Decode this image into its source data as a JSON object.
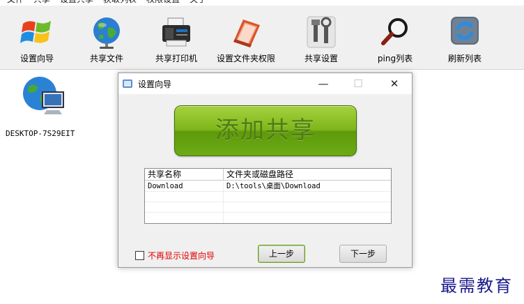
{
  "menubar": {
    "items": [
      "文件",
      "共享",
      "设置共享",
      "获取列表",
      "权限设置",
      "关于"
    ]
  },
  "toolbar": {
    "buttons": [
      {
        "label": "设置向导",
        "icon": "windows-logo-icon"
      },
      {
        "label": "共享文件",
        "icon": "globe-icon"
      },
      {
        "label": "共享打印机",
        "icon": "printer-icon"
      },
      {
        "label": "设置文件夹权限",
        "icon": "folder-permission-icon"
      },
      {
        "label": "共享设置",
        "icon": "tools-icon"
      },
      {
        "label": "ping列表",
        "icon": "magnifier-icon"
      },
      {
        "label": "刷新列表",
        "icon": "refresh-icon"
      }
    ]
  },
  "host": {
    "name": "DESKTOP-7S29EIT",
    "icon": "network-computer-icon"
  },
  "dialog": {
    "title": "设置向导",
    "minimize": "—",
    "maximize": "☐",
    "close": "✕",
    "add_share_label": "添加共享",
    "table": {
      "columns": [
        "共享名称",
        "文件夹或磁盘路径"
      ],
      "rows": [
        [
          "Download",
          "D:\\tools\\桌面\\Download"
        ]
      ]
    },
    "dont_show_label": "不再显示设置向导",
    "prev_label": "上一步",
    "next_label": "下一步"
  },
  "watermark": "最需教育",
  "colors": {
    "add_button_green": "#7fb61a",
    "checkbox_label_red": "#e00000",
    "watermark_blue": "#1a1a8c"
  }
}
